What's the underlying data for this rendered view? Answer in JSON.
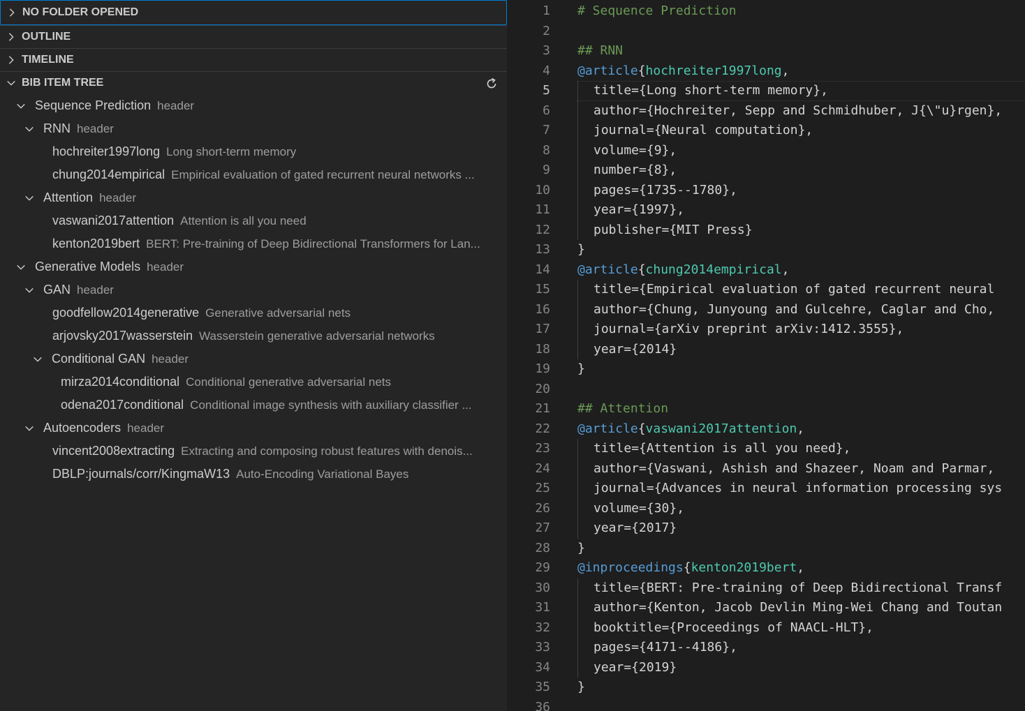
{
  "sidebar": {
    "sections": {
      "no_folder": "NO FOLDER OPENED",
      "outline": "OUTLINE",
      "timeline": "TIMELINE",
      "bib_tree": "BIB ITEM TREE"
    },
    "tree": [
      {
        "label": "Sequence Prediction",
        "desc": "header"
      },
      {
        "label": "RNN",
        "desc": "header"
      },
      {
        "label": "hochreiter1997long",
        "desc": "Long short-term memory"
      },
      {
        "label": "chung2014empirical",
        "desc": "Empirical evaluation of gated recurrent neural networks ..."
      },
      {
        "label": "Attention",
        "desc": "header"
      },
      {
        "label": "vaswani2017attention",
        "desc": "Attention is all you need"
      },
      {
        "label": "kenton2019bert",
        "desc": "BERT: Pre-training of Deep Bidirectional Transformers for Lan..."
      },
      {
        "label": "Generative Models",
        "desc": "header"
      },
      {
        "label": "GAN",
        "desc": "header"
      },
      {
        "label": "goodfellow2014generative",
        "desc": "Generative adversarial nets"
      },
      {
        "label": "arjovsky2017wasserstein",
        "desc": "Wasserstein generative adversarial networks"
      },
      {
        "label": "Conditional GAN",
        "desc": "header"
      },
      {
        "label": "mirza2014conditional",
        "desc": "Conditional generative adversarial nets"
      },
      {
        "label": "odena2017conditional",
        "desc": "Conditional image synthesis with auxiliary classifier ..."
      },
      {
        "label": "Autoencoders",
        "desc": "header"
      },
      {
        "label": "vincent2008extracting",
        "desc": "Extracting and composing robust features with denois..."
      },
      {
        "label": "DBLP:journals/corr/KingmaW13",
        "desc": "Auto-Encoding Variational Bayes"
      }
    ]
  },
  "editor": {
    "active_line": "5",
    "lines": [
      {
        "n": "1",
        "a": "# Sequence Prediction"
      },
      {
        "n": "2"
      },
      {
        "n": "3",
        "a": "## RNN"
      },
      {
        "n": "4",
        "a": "@article",
        "b": "{",
        "c": "hochreiter1997long",
        "d": ","
      },
      {
        "n": "5",
        "t": "title={Long short-term memory},"
      },
      {
        "n": "6",
        "t": "author={Hochreiter, Sepp and Schmidhuber, J{\\\"u}rgen},"
      },
      {
        "n": "7",
        "t": "journal={Neural computation},"
      },
      {
        "n": "8",
        "t": "volume={9},"
      },
      {
        "n": "9",
        "t": "number={8},"
      },
      {
        "n": "10",
        "t": "pages={1735--1780},"
      },
      {
        "n": "11",
        "t": "year={1997},"
      },
      {
        "n": "12",
        "t": "publisher={MIT Press}"
      },
      {
        "n": "13",
        "t": "}"
      },
      {
        "n": "14",
        "a": "@article",
        "b": "{",
        "c": "chung2014empirical",
        "d": ","
      },
      {
        "n": "15",
        "t": "title={Empirical evaluation of gated recurrent neural"
      },
      {
        "n": "16",
        "t": "author={Chung, Junyoung and Gulcehre, Caglar and Cho,"
      },
      {
        "n": "17",
        "t": "journal={arXiv preprint arXiv:1412.3555},"
      },
      {
        "n": "18",
        "t": "year={2014}"
      },
      {
        "n": "19",
        "t": "}"
      },
      {
        "n": "20"
      },
      {
        "n": "21",
        "a": "## Attention"
      },
      {
        "n": "22",
        "a": "@article",
        "b": "{",
        "c": "vaswani2017attention",
        "d": ","
      },
      {
        "n": "23",
        "t": "title={Attention is all you need},"
      },
      {
        "n": "24",
        "t": "author={Vaswani, Ashish and Shazeer, Noam and Parmar,"
      },
      {
        "n": "25",
        "t": "journal={Advances in neural information processing sys"
      },
      {
        "n": "26",
        "t": "volume={30},"
      },
      {
        "n": "27",
        "t": "year={2017}"
      },
      {
        "n": "28",
        "t": "}"
      },
      {
        "n": "29",
        "a": "@inproceedings",
        "b": "{",
        "c": "kenton2019bert",
        "d": ","
      },
      {
        "n": "30",
        "t": "title={BERT: Pre-training of Deep Bidirectional Transf"
      },
      {
        "n": "31",
        "t": "author={Kenton, Jacob Devlin Ming-Wei Chang and Toutan"
      },
      {
        "n": "32",
        "t": "booktitle={Proceedings of NAACL-HLT},"
      },
      {
        "n": "33",
        "t": "pages={4171--4186},"
      },
      {
        "n": "34",
        "t": "year={2019}"
      },
      {
        "n": "35",
        "t": "}"
      },
      {
        "n": "36"
      }
    ]
  },
  "colors": {
    "sidebar_bg": "#252526",
    "editor_bg": "#1e1e1e",
    "focus_border": "#007fd4",
    "markdown_heading": "#6a9955",
    "bib_type": "#569cd6",
    "bib_key": "#4ec9b0"
  },
  "icons": {
    "collapsed": "chevron-right-icon",
    "expanded": "chevron-down-icon",
    "refresh": "refresh-icon"
  }
}
